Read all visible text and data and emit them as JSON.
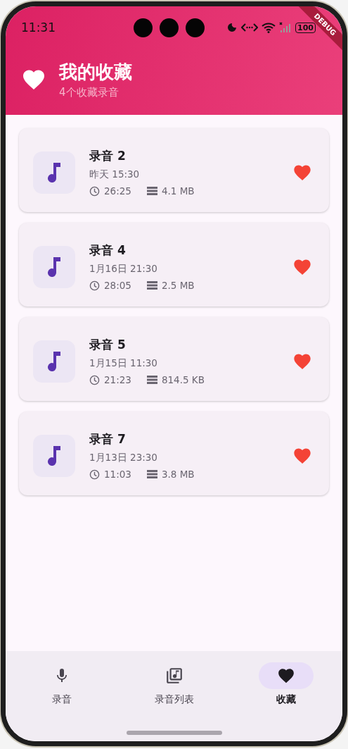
{
  "status_bar": {
    "time": "11:31",
    "battery": "100"
  },
  "debug_banner": "DEBUG",
  "header": {
    "title": "我的收藏",
    "subtitle": "4个收藏录音"
  },
  "recordings": [
    {
      "title": "录音 2",
      "date": "昨天 15:30",
      "duration": "26:25",
      "size": "4.1 MB",
      "favorite": true
    },
    {
      "title": "录音 4",
      "date": "1月16日 21:30",
      "duration": "28:05",
      "size": "2.5 MB",
      "favorite": true
    },
    {
      "title": "录音 5",
      "date": "1月15日 11:30",
      "duration": "21:23",
      "size": "814.5 KB",
      "favorite": true
    },
    {
      "title": "录音 7",
      "date": "1月13日 23:30",
      "duration": "11:03",
      "size": "3.8 MB",
      "favorite": true
    }
  ],
  "nav": [
    {
      "label": "录音",
      "kind": "mic",
      "selected": false
    },
    {
      "label": "录音列表",
      "kind": "library",
      "selected": false
    },
    {
      "label": "收藏",
      "kind": "heart",
      "selected": true
    }
  ]
}
